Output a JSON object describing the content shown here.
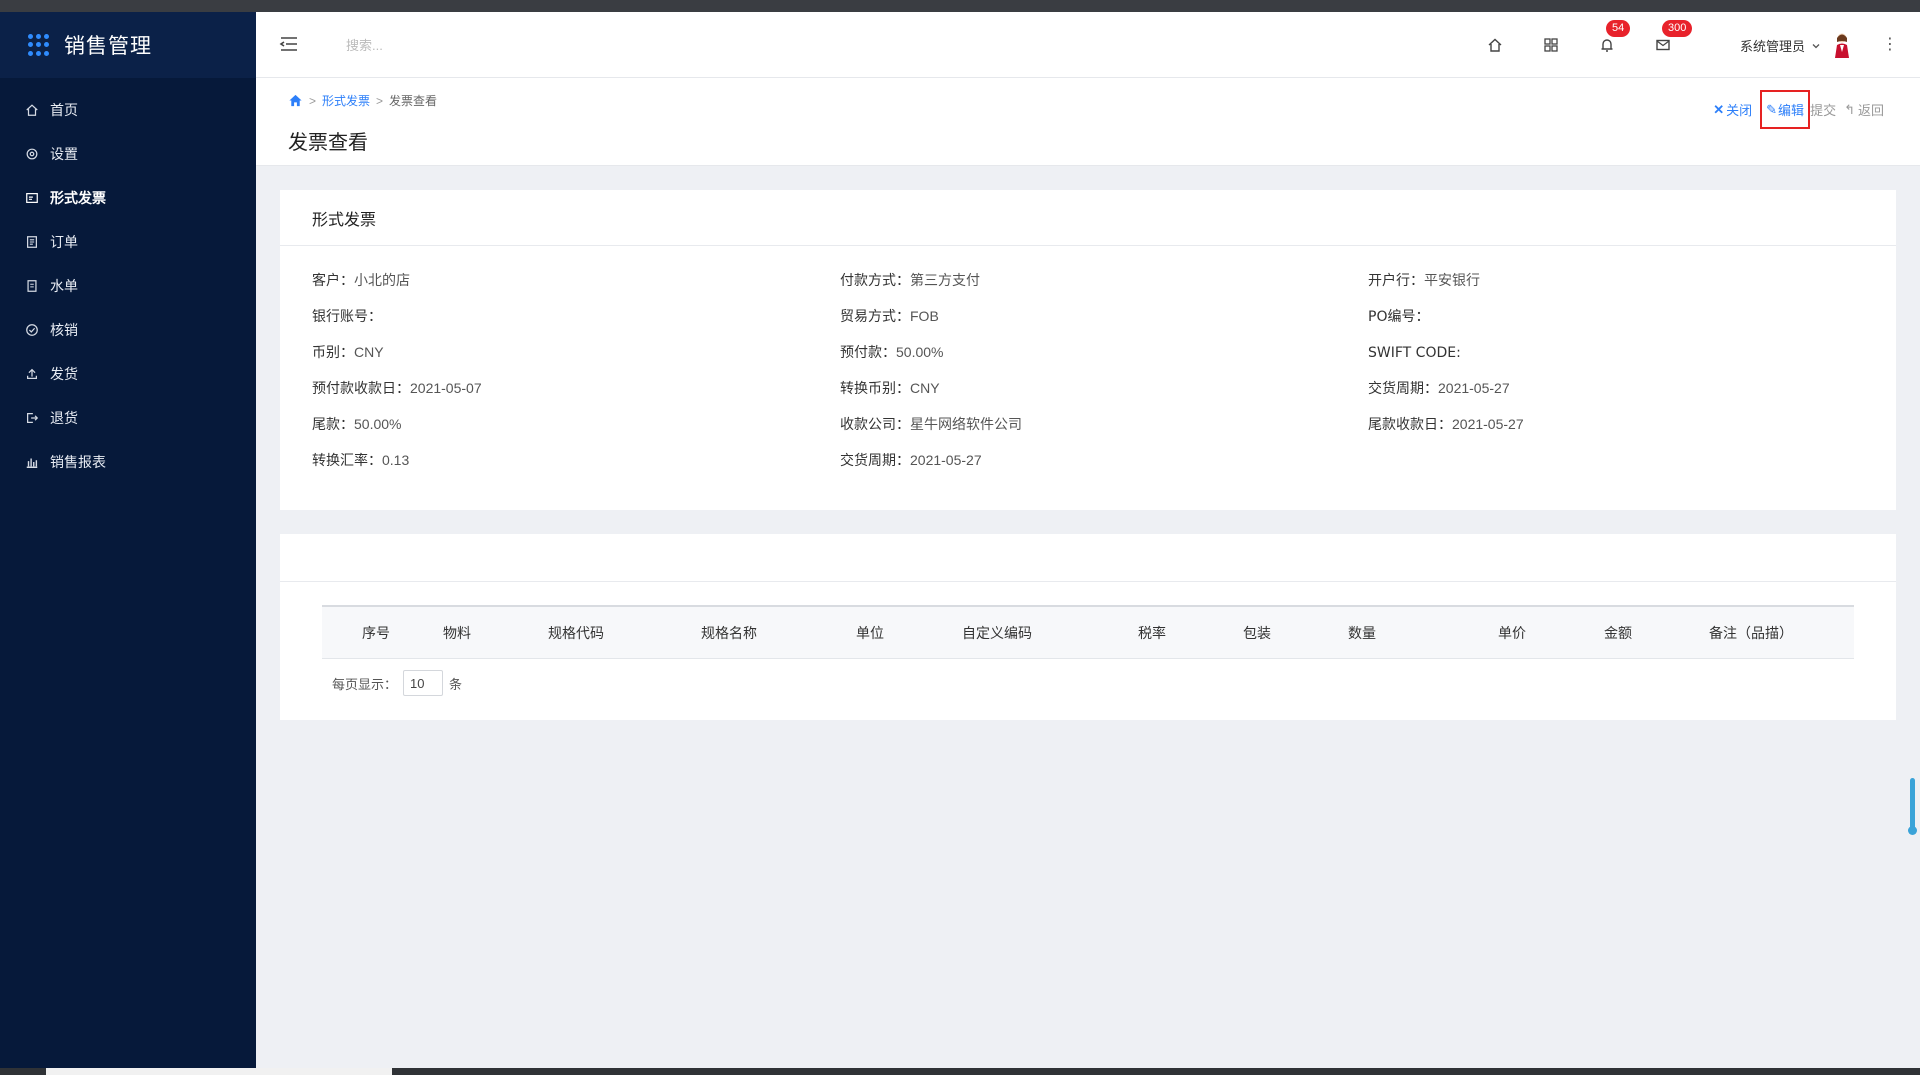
{
  "app": {
    "title": "销售管理"
  },
  "sidebar": {
    "items": [
      {
        "label": "首页",
        "icon": "home-icon"
      },
      {
        "label": "设置",
        "icon": "gear-icon"
      },
      {
        "label": "形式发票",
        "icon": "invoice-icon"
      },
      {
        "label": "订单",
        "icon": "order-icon"
      },
      {
        "label": "水单",
        "icon": "receipt-icon"
      },
      {
        "label": "核销",
        "icon": "check-circle-icon"
      },
      {
        "label": "发货",
        "icon": "upload-icon"
      },
      {
        "label": "退货",
        "icon": "logout-icon"
      },
      {
        "label": "销售报表",
        "icon": "bar-chart-icon"
      }
    ]
  },
  "header": {
    "search_placeholder": "搜索...",
    "notifications_badge": "54",
    "messages_badge": "300",
    "user_name": "系统管理员"
  },
  "breadcrumb": {
    "parent": "形式发票",
    "current": "发票查看"
  },
  "page": {
    "title": "发票查看"
  },
  "actions": {
    "close": "关闭",
    "edit": "编辑",
    "submit": "提交",
    "back": "返回"
  },
  "invoice": {
    "section_title": "形式发票",
    "fields": [
      {
        "label": "客户：",
        "value": "小北的店"
      },
      {
        "label": "付款方式：",
        "value": "第三方支付"
      },
      {
        "label": "开户行：",
        "value": "平安银行"
      },
      {
        "label": "银行账号：",
        "value": ""
      },
      {
        "label": "贸易方式：",
        "value": "FOB"
      },
      {
        "label": "PO编号：",
        "value": ""
      },
      {
        "label": "币别：",
        "value": "CNY"
      },
      {
        "label": "预付款：",
        "value": "50.00%"
      },
      {
        "label": "SWIFT CODE:",
        "value": ""
      },
      {
        "label": "预付款收款日：",
        "value": "2021-05-07"
      },
      {
        "label": "转换币别：",
        "value": "CNY"
      },
      {
        "label": "交货周期：",
        "value": "2021-05-27"
      },
      {
        "label": "尾款：",
        "value": "50.00%"
      },
      {
        "label": "收款公司：",
        "value": "星牛网络软件公司"
      },
      {
        "label": "尾款收款日：",
        "value": "2021-05-27"
      },
      {
        "label": "转换汇率：",
        "value": "0.13"
      },
      {
        "label": "交货周期：",
        "value": "2021-05-27"
      }
    ]
  },
  "table": {
    "columns": [
      "序号",
      "物料",
      "规格代码",
      "规格名称",
      "单位",
      "自定义编码",
      "税率",
      "包装",
      "数量",
      "单价",
      "金额",
      "备注（品描）"
    ]
  },
  "pager": {
    "label": "每页显示：",
    "size": "10",
    "unit": "条"
  },
  "colors": {
    "sidebar_bg": "#06193a",
    "accent": "#2d7ff9",
    "badge": "#e8222b",
    "highlight": "#e62222"
  }
}
